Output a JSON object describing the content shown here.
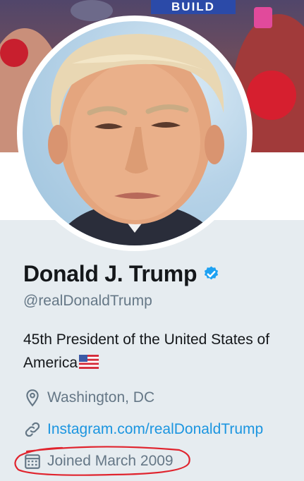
{
  "banner": {
    "sign_text": "BUILD"
  },
  "profile": {
    "name": "Donald J. Trump",
    "verified": true,
    "handle": "@realDonaldTrump",
    "bio": "45th President of the United States of America",
    "bio_emoji": "us-flag-icon"
  },
  "meta": {
    "location": "Washington, DC",
    "website": "Instagram.com/realDonaldTrump",
    "joined": "Joined March 2009"
  },
  "colors": {
    "text_primary": "#14171a",
    "text_secondary": "#657786",
    "link": "#1b95e0",
    "verified_badge": "#1da1f2",
    "background": "#e6ecf0",
    "annotation_ring": "#e0242e"
  }
}
